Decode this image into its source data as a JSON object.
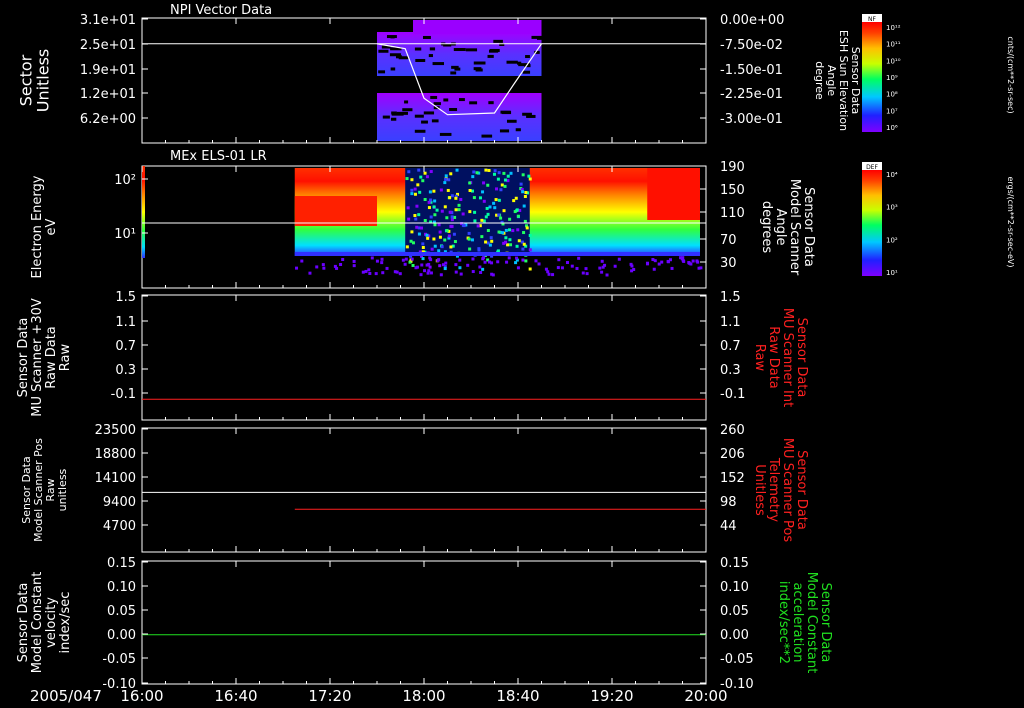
{
  "date_label": "2005/047",
  "time_ticks": [
    "16:00",
    "16:40",
    "17:20",
    "18:00",
    "18:40",
    "19:20",
    "20:00"
  ],
  "chart_data": [
    {
      "type": "heatmap",
      "title": "NPI Vector Data",
      "ylabel": [
        "Sector",
        "Unitless"
      ],
      "yticks": [
        "3.1e+01",
        "2.5e+01",
        "1.9e+01",
        "1.2e+01",
        "6.2e+00"
      ],
      "right_ylabel": [
        "Sensor Data",
        "ESH Sun Elevation",
        "Angle",
        "degree"
      ],
      "right_yticks": [
        "0.00e+00",
        "-7.50e-02",
        "-1.50e-01",
        "-2.25e-01",
        "-3.00e-01"
      ],
      "colorbar": {
        "label": "NF",
        "unit": "cnts/(cm**2-sr-sec)",
        "ticks": [
          "10¹²",
          "10¹¹",
          "10¹⁰",
          "10⁹",
          "10⁸",
          "10⁷",
          "10⁶"
        ]
      },
      "data_time_range": [
        "17:40",
        "18:50"
      ],
      "overlay_line": {
        "color": "#ffffff",
        "x": [
          "17:40",
          "17:52",
          "18:00",
          "18:10",
          "18:30",
          "18:38",
          "18:50"
        ],
        "y": [
          -0.075,
          -0.09,
          -0.24,
          -0.29,
          -0.285,
          -0.2,
          -0.075
        ]
      }
    },
    {
      "type": "heatmap",
      "title": "MEx ELS-01 LR",
      "ylabel": [
        "Electron Energy",
        "eV"
      ],
      "yticks": [
        "10²",
        "10¹"
      ],
      "right_ylabel": [
        "Sensor Data",
        "Model Scanner",
        "Angle",
        "degrees"
      ],
      "right_yticks": [
        "190",
        "150",
        "110",
        "70",
        "30"
      ],
      "colorbar": {
        "label": "DEF",
        "unit": "ergs/(cm**2-sr-sec-eV)",
        "ticks": [
          "10⁴",
          "10³",
          "10²",
          "10¹"
        ]
      },
      "overlay_line": {
        "color": "#ffffff",
        "value": 95
      }
    },
    {
      "type": "line",
      "ylabel": [
        "Sensor Data",
        "MU Scanner +30V",
        "Raw Data",
        "Raw"
      ],
      "yticks": [
        "1.5",
        "1.1",
        "0.7",
        "0.3",
        "-0.1"
      ],
      "ylim": [
        -0.3,
        1.5
      ],
      "right_ylabel": [
        "Sensor Data",
        "MU Scanner Int",
        "Raw Data",
        "Raw"
      ],
      "right_yticks": [
        "1.5",
        "1.1",
        "0.7",
        "0.3",
        "-0.1"
      ],
      "series": [
        {
          "color": "#ff2020",
          "x": [
            "16:00",
            "20:00"
          ],
          "y": [
            0.0,
            0.0
          ]
        }
      ]
    },
    {
      "type": "line",
      "ylabel": [
        "Sensor Data",
        "Model Scanner Pos",
        "Raw",
        "unitless"
      ],
      "yticks": [
        "23500",
        "18800",
        "14100",
        "9400",
        "4700"
      ],
      "ylim": [
        0,
        23500
      ],
      "right_ylabel": [
        "Sensor Data",
        "MU Scanner Pos",
        "Telemetry",
        "Unitless"
      ],
      "right_yticks": [
        "260",
        "206",
        "152",
        "98",
        "44"
      ],
      "series": [
        {
          "color": "#ffffff",
          "x": [
            "16:00",
            "20:00"
          ],
          "y": [
            11300,
            11300
          ]
        },
        {
          "color": "#ff2020",
          "x": [
            "17:05",
            "20:00"
          ],
          "y": [
            8100,
            8100
          ]
        }
      ]
    },
    {
      "type": "line",
      "ylabel": [
        "Sensor Data",
        "Model Constant",
        "velocity",
        "index/sec"
      ],
      "yticks": [
        "0.15",
        "0.10",
        "0.05",
        "0.00",
        "-0.05",
        "-0.10"
      ],
      "ylim": [
        -0.1,
        0.15
      ],
      "right_ylabel": [
        "Sensor Data",
        "Model Constant",
        "acceleration",
        "index/sec**2"
      ],
      "right_yticks": [
        "0.15",
        "0.10",
        "0.05",
        "0.00",
        "-0.05",
        "-0.10"
      ],
      "series": [
        {
          "color": "#20e020",
          "x": [
            "16:00",
            "20:00"
          ],
          "y": [
            0.0,
            0.0
          ]
        }
      ]
    }
  ]
}
